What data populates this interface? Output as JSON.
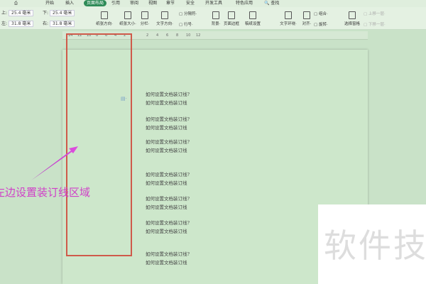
{
  "menu": {
    "tabs": [
      "开始",
      "插入",
      "页面布局",
      "引用",
      "审阅",
      "视图",
      "章节",
      "安全",
      "开发工具",
      "特色应用"
    ],
    "search": "查找"
  },
  "margins": {
    "top_label": "上:",
    "top": "25.4 毫米",
    "bottom_label": "下:",
    "bottom": "25.4 毫米",
    "left_label": "左:",
    "left": "31.8 毫米",
    "right_label": "右:",
    "right": "31.8 毫米"
  },
  "toolbar": [
    "纸张方向·",
    "纸张大小·",
    "分栏·",
    "文字方向·",
    "背景·",
    "页面边框",
    "稿纸设置",
    "文字环绕·",
    "对齐·",
    "选择窗格"
  ],
  "small": {
    "separator": "分隔符·",
    "line_numbers": "行号·",
    "group": "组合·",
    "rotate": "旋转·",
    "up": "上移一层·",
    "down": "下移一层·"
  },
  "ruler": [
    "14",
    "12",
    "10",
    "8",
    "6",
    "4",
    "2",
    "2",
    "4",
    "6",
    "8",
    "10",
    "12"
  ],
  "doc_lines": [
    "如何设置文档装订线?",
    "如何设置文档装订线"
  ],
  "annotation": "左边设置装订线区域",
  "watermark": "软件技",
  "colors": {
    "accent": "#2e8b57",
    "highlight": "#cf5a4a",
    "annotation": "#d040c8"
  }
}
